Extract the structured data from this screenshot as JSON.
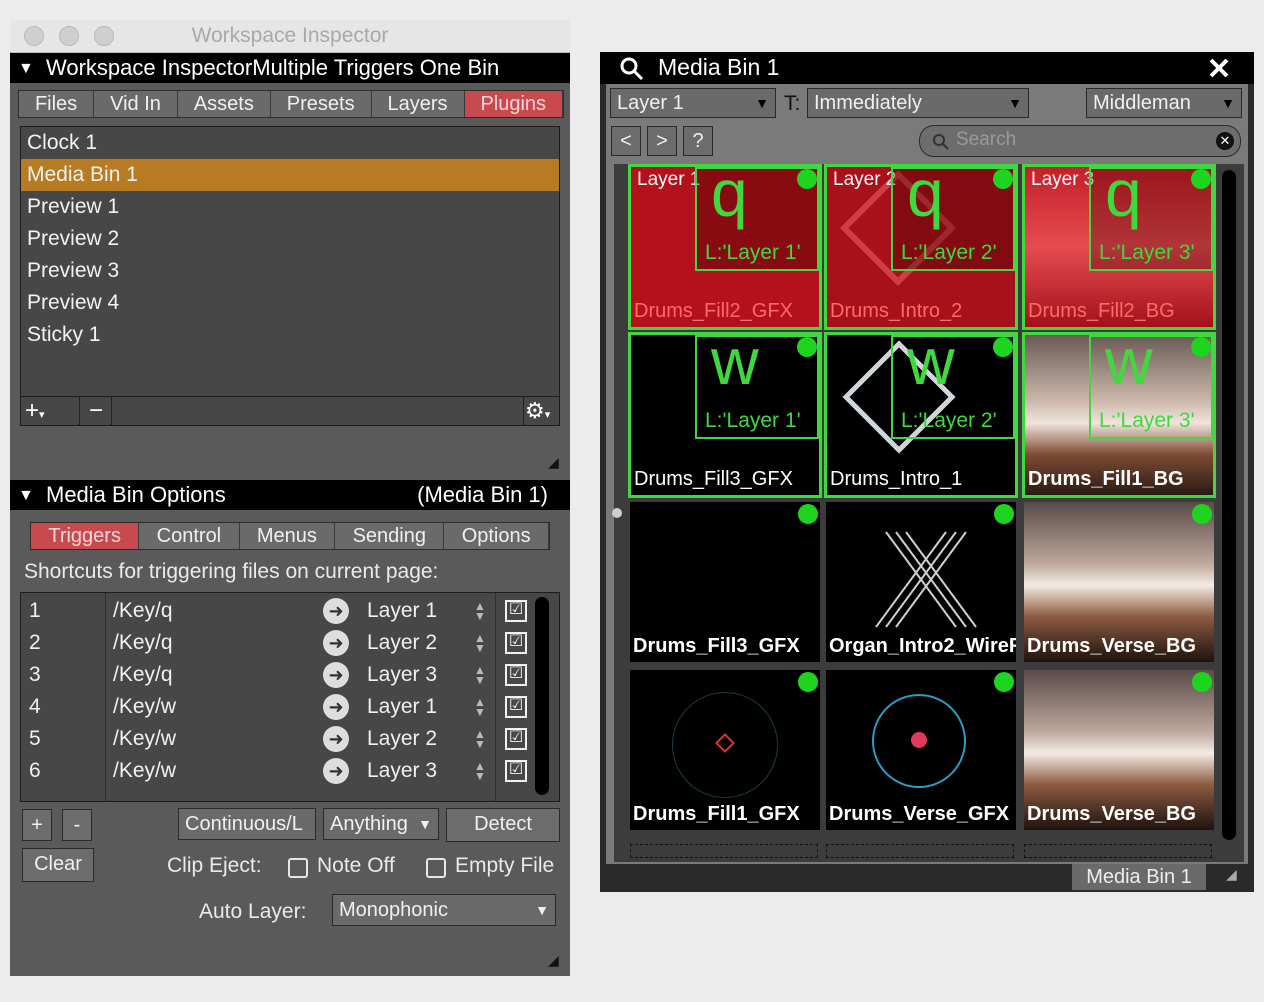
{
  "inspector": {
    "window_title": "Workspace Inspector",
    "header_title": "Workspace InspectorMultiple Triggers One Bin",
    "tabs": [
      "Files",
      "Vid In",
      "Assets",
      "Presets",
      "Layers",
      "Plugins"
    ],
    "active_tab": "Plugins",
    "plugins": [
      "Clock 1",
      "Media Bin 1",
      "Preview 1",
      "Preview 2",
      "Preview 3",
      "Preview 4",
      "Sticky 1"
    ],
    "selected_plugin": "Media Bin 1",
    "add_symbol": "+",
    "remove_symbol": "−"
  },
  "options": {
    "header_title": "Media Bin Options",
    "header_target": "(Media Bin 1)",
    "tabs": [
      "Triggers",
      "Control",
      "Menus",
      "Sending",
      "Options"
    ],
    "active_tab": "Triggers",
    "description": "Shortcuts for triggering files on current page:",
    "rows": [
      {
        "num": "1",
        "key": "/Key/q",
        "layer": "Layer 1",
        "check": "☑"
      },
      {
        "num": "2",
        "key": "/Key/q",
        "layer": "Layer 2",
        "check": "☑"
      },
      {
        "num": "3",
        "key": "/Key/q",
        "layer": "Layer 3",
        "check": "☑"
      },
      {
        "num": "4",
        "key": "/Key/w",
        "layer": "Layer 1",
        "check": "☑"
      },
      {
        "num": "5",
        "key": "/Key/w",
        "layer": "Layer 2",
        "check": "☑"
      },
      {
        "num": "6",
        "key": "/Key/w",
        "layer": "Layer 3",
        "check": "☑"
      }
    ],
    "plus_label": "+",
    "minus_label": "-",
    "continuous_label": "Continuous/L",
    "anything_label": "Anything",
    "detect_label": "Detect",
    "clear_label": "Clear",
    "clip_eject_label": "Clip Eject:",
    "note_off_label": "Note Off",
    "empty_file_label": "Empty File",
    "auto_layer_label": "Auto Layer:",
    "auto_layer_value": "Monophonic"
  },
  "mediabin": {
    "title": "Media Bin 1",
    "layer_select": "Layer 1",
    "t_label": "T:",
    "timing_select": "Immediately",
    "middleman_select": "Middleman",
    "nav": [
      "<",
      ">",
      "?"
    ],
    "search_placeholder": "Search",
    "page_tab": "Media Bin 1",
    "cells": [
      {
        "name": "Drums_Fill2_GFX",
        "layer_tag": "Layer 1",
        "trig_key": "q",
        "trig_layer": "L:'Layer 1'"
      },
      {
        "name": "Drums_Intro_2",
        "layer_tag": "Layer 2",
        "trig_key": "q",
        "trig_layer": "L:'Layer 2'"
      },
      {
        "name": "Drums_Fill2_BG",
        "layer_tag": "Layer 3",
        "trig_key": "q",
        "trig_layer": "L:'Layer 3'"
      },
      {
        "name": "Drums_Fill3_GFX",
        "trig_key": "w",
        "trig_layer": "L:'Layer 1'"
      },
      {
        "name": "Drums_Intro_1",
        "trig_key": "w",
        "trig_layer": "L:'Layer 2'"
      },
      {
        "name": "Drums_Fill1_BG",
        "trig_key": "w",
        "trig_layer": "L:'Layer 3'"
      },
      {
        "name": "Drums_Fill3_GFX"
      },
      {
        "name": "Organ_Intro2_WireF"
      },
      {
        "name": "Drums_Verse_BG"
      },
      {
        "name": "Drums_Fill1_GFX"
      },
      {
        "name": "Drums_Verse_GFX"
      },
      {
        "name": "Drums_Verse_BG"
      }
    ]
  },
  "colors": {
    "active_tab": "#c84a4f",
    "selection": "#b87b22",
    "trigger_green": "#3fd93f",
    "playing_red": "#b3121c"
  }
}
